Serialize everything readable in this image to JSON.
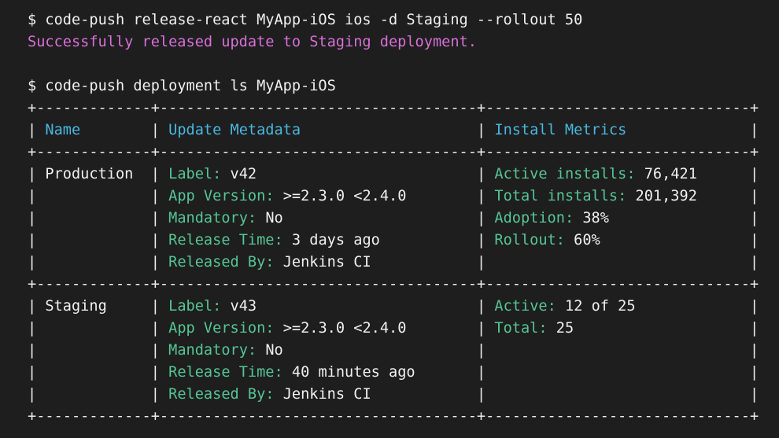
{
  "commands": [
    {
      "prompt": "$",
      "text": "code-push release-react MyApp-iOS ios -d Staging --rollout 50",
      "output": "Successfully released update to Staging deployment."
    },
    {
      "prompt": "$",
      "text": "code-push deployment ls MyApp-iOS"
    }
  ],
  "table": {
    "border_line": "+--------------------------------------------------------------------------------+",
    "headers": [
      "Name",
      "Update Metadata",
      "Install Metrics"
    ],
    "rows": [
      {
        "name": "Production",
        "metadata": [
          {
            "key": "Label:",
            "value": "v42"
          },
          {
            "key": "App Version:",
            "value": ">=2.3.0 <2.4.0"
          },
          {
            "key": "Mandatory:",
            "value": "No"
          },
          {
            "key": "Release Time:",
            "value": "3 days ago"
          },
          {
            "key": "Released By:",
            "value": "Jenkins CI"
          }
        ],
        "metrics": [
          {
            "key": "Active installs:",
            "value": "76,421"
          },
          {
            "key": "Total installs:",
            "value": "201,392"
          },
          {
            "key": "Adoption:",
            "value": "38%"
          },
          {
            "key": "Rollout:",
            "value": "60%"
          }
        ]
      },
      {
        "name": "Staging",
        "metadata": [
          {
            "key": "Label:",
            "value": "v43"
          },
          {
            "key": "App Version:",
            "value": ">=2.3.0 <2.4.0"
          },
          {
            "key": "Mandatory:",
            "value": "No"
          },
          {
            "key": "Release Time:",
            "value": "40 minutes ago"
          },
          {
            "key": "Released By:",
            "value": "Jenkins CI"
          }
        ],
        "metrics": [
          {
            "key": "Active:",
            "value": "12 of 25"
          },
          {
            "key": "Total:",
            "value": "25"
          }
        ]
      }
    ]
  },
  "colors": {
    "background": "#1e1e1e",
    "text": "#f0f0f0",
    "success": "#d86fd8",
    "header": "#49b6df",
    "key": "#56c596"
  }
}
